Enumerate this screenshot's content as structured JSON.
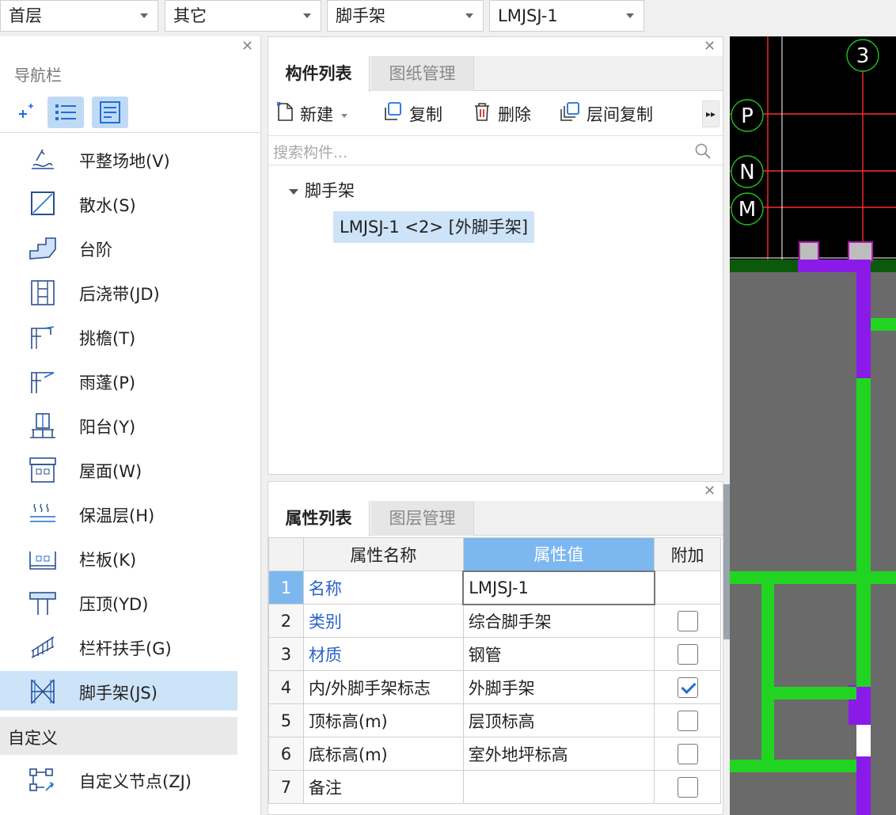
{
  "toolbar": {
    "floor": "首层",
    "category": "其它",
    "component_type": "脚手架",
    "component": "LMJSJ-1"
  },
  "nav": {
    "title": "导航栏",
    "items": [
      {
        "label": "平整场地(V)",
        "icon": "leveling-icon"
      },
      {
        "label": "散水(S)",
        "icon": "apron-icon"
      },
      {
        "label": "台阶",
        "icon": "steps-icon"
      },
      {
        "label": "后浇带(JD)",
        "icon": "post-cast-strip-icon"
      },
      {
        "label": "挑檐(T)",
        "icon": "cornice-icon"
      },
      {
        "label": "雨蓬(P)",
        "icon": "canopy-icon"
      },
      {
        "label": "阳台(Y)",
        "icon": "balcony-icon"
      },
      {
        "label": "屋面(W)",
        "icon": "roof-icon"
      },
      {
        "label": "保温层(H)",
        "icon": "insulation-icon"
      },
      {
        "label": "栏板(K)",
        "icon": "parapet-icon"
      },
      {
        "label": "压顶(YD)",
        "icon": "coping-icon"
      },
      {
        "label": "栏杆扶手(G)",
        "icon": "railing-icon"
      },
      {
        "label": "脚手架(JS)",
        "icon": "scaffold-icon"
      }
    ],
    "group": "自定义",
    "group_items": [
      {
        "label": "自定义节点(ZJ)",
        "icon": "custom-node-icon"
      }
    ]
  },
  "component_panel": {
    "tabs": [
      "构件列表",
      "图纸管理"
    ],
    "actions": {
      "new": "新建",
      "copy": "复制",
      "delete": "删除",
      "floor_copy": "层间复制"
    },
    "search_placeholder": "搜索构件...",
    "tree_root": "脚手架",
    "tree_child": "LMJSJ-1 <2> [外脚手架]"
  },
  "property_panel": {
    "tabs": [
      "属性列表",
      "图层管理"
    ],
    "headers": {
      "name": "属性名称",
      "value": "属性值",
      "extra": "附加"
    },
    "rows": [
      {
        "no": "1",
        "name": "名称",
        "value": "LMJSJ-1"
      },
      {
        "no": "2",
        "name": "类别",
        "value": "综合脚手架",
        "checked": false
      },
      {
        "no": "3",
        "name": "材质",
        "value": "钢管",
        "checked": false
      },
      {
        "no": "4",
        "name": "内/外脚手架标志",
        "value": "外脚手架",
        "checked": true
      },
      {
        "no": "5",
        "name": "顶标高(m)",
        "value": "层顶标高",
        "checked": false
      },
      {
        "no": "6",
        "name": "底标高(m)",
        "value": "室外地坪标高",
        "checked": false
      },
      {
        "no": "7",
        "name": "备注",
        "value": "",
        "checked": false
      }
    ]
  },
  "cad": {
    "axis_labels": [
      "3",
      "P",
      "N",
      "M"
    ]
  },
  "colors": {
    "selection": "#cde3f8",
    "header_highlight": "#7cb8ef",
    "link_blue": "#2a62c9",
    "cad_green": "#22d422",
    "cad_purple": "#8a1ae8",
    "cad_gray": "#6a6a6a"
  }
}
